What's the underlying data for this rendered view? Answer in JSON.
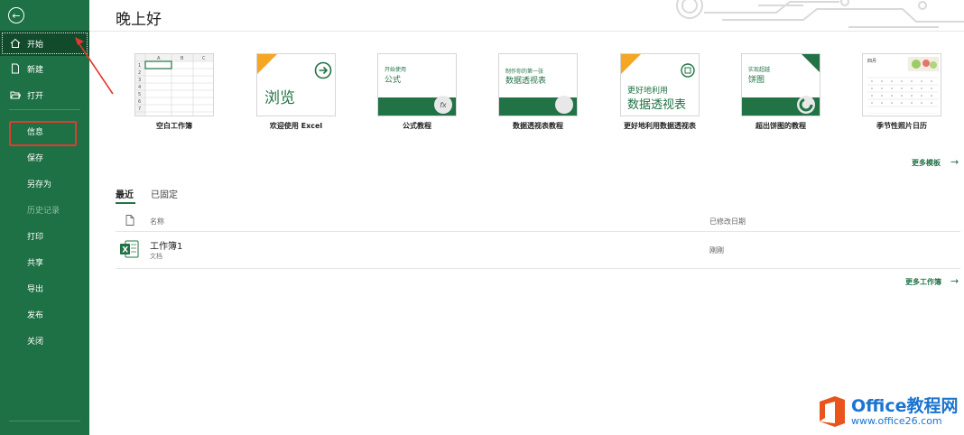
{
  "sidebar": {
    "items": [
      {
        "label": "开始"
      },
      {
        "label": "新建"
      },
      {
        "label": "打开"
      },
      {
        "label": "信息"
      },
      {
        "label": "保存"
      },
      {
        "label": "另存为"
      },
      {
        "label": "历史记录"
      },
      {
        "label": "打印"
      },
      {
        "label": "共享"
      },
      {
        "label": "导出"
      },
      {
        "label": "发布"
      },
      {
        "label": "关闭"
      }
    ]
  },
  "header": {
    "greeting": "晚上好"
  },
  "templates": {
    "items": [
      {
        "label": "空白工作簿"
      },
      {
        "label": "欢迎使用 Excel",
        "thumb_text": "浏览"
      },
      {
        "label": "公式教程",
        "thumb_small": "开始使用",
        "thumb_big": "公式",
        "thumb_icon": "fx"
      },
      {
        "label": "数据透视表教程",
        "thumb_small": "制作你的第一张",
        "thumb_big": "数据透视表"
      },
      {
        "label": "更好地利用数据透视表",
        "thumb_small": "更好地利用",
        "thumb_big": "数据透视表"
      },
      {
        "label": "超出饼图的教程",
        "thumb_small": "实现超越",
        "thumb_big": "饼图"
      },
      {
        "label": "季节性照片日历",
        "thumb_small": "四月"
      }
    ],
    "more_label": "更多模板"
  },
  "tabs": {
    "recent": "最近",
    "pinned": "已固定"
  },
  "file_list": {
    "col_name": "名称",
    "col_date": "已修改日期",
    "rows": [
      {
        "name": "工作簿1",
        "type": "文档",
        "date": "刚刚"
      }
    ],
    "more_label": "更多工作簿"
  },
  "watermark": {
    "title": "Office教程网",
    "url": "www.office26.com"
  },
  "colors": {
    "brand": "#217346",
    "sidebar": "#1e7145",
    "highlight": "#e23a2f"
  }
}
